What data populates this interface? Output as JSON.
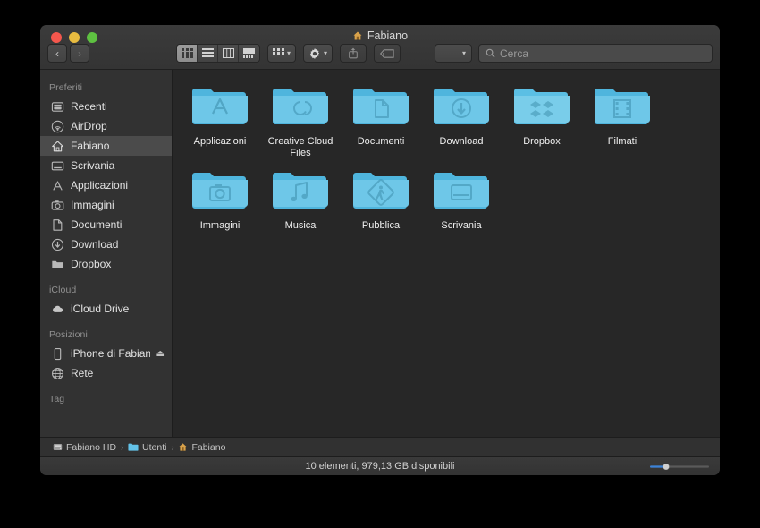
{
  "window": {
    "title": "Fabiano",
    "title_icon": "home-icon",
    "traffic_lights": [
      "close",
      "minimize",
      "zoom"
    ],
    "colors": {
      "red": "#f4574d",
      "yellow": "#e8bb40",
      "green": "#5ec141",
      "folder": "#63c2e8",
      "accent": "#3b7fd4"
    }
  },
  "toolbar": {
    "back_label": "‹",
    "forward_label": "›",
    "view_modes": [
      {
        "name": "icon-view",
        "active": true
      },
      {
        "name": "list-view",
        "active": false
      },
      {
        "name": "column-view",
        "active": false
      },
      {
        "name": "gallery-view",
        "active": false
      }
    ],
    "arrange_label": "arrange-icon",
    "action_label": "gear-icon",
    "share_label": "share-icon",
    "tag_label": "tag-icon",
    "popup_label": "item-popup"
  },
  "search": {
    "placeholder": "Cerca",
    "value": "",
    "icon": "search-icon"
  },
  "sidebar": {
    "sections": [
      {
        "header": "Preferiti",
        "items": [
          {
            "label": "Recenti",
            "icon": "clock-recents-icon",
            "selected": false
          },
          {
            "label": "AirDrop",
            "icon": "airdrop-icon",
            "selected": false
          },
          {
            "label": "Fabiano",
            "icon": "home-icon",
            "selected": true
          },
          {
            "label": "Scrivania",
            "icon": "desktop-icon",
            "selected": false
          },
          {
            "label": "Applicazioni",
            "icon": "applications-icon",
            "selected": false
          },
          {
            "label": "Immagini",
            "icon": "pictures-icon",
            "selected": false
          },
          {
            "label": "Documenti",
            "icon": "documents-icon",
            "selected": false
          },
          {
            "label": "Download",
            "icon": "downloads-icon",
            "selected": false
          },
          {
            "label": "Dropbox",
            "icon": "folder-icon",
            "selected": false
          }
        ]
      },
      {
        "header": "iCloud",
        "items": [
          {
            "label": "iCloud Drive",
            "icon": "cloud-icon",
            "selected": false
          }
        ]
      },
      {
        "header": "Posizioni",
        "items": [
          {
            "label": "iPhone di Fabian…",
            "icon": "iphone-icon",
            "selected": false,
            "eject": "⏏"
          },
          {
            "label": "Rete",
            "icon": "network-globe-icon",
            "selected": false
          }
        ]
      },
      {
        "header": "Tag",
        "items": []
      }
    ]
  },
  "content": {
    "items": [
      {
        "name": "Applicazioni",
        "glyph": "applications-folder"
      },
      {
        "name": "Creative Cloud Files",
        "glyph": "creative-cloud-folder"
      },
      {
        "name": "Documenti",
        "glyph": "documents-folder"
      },
      {
        "name": "Download",
        "glyph": "downloads-folder"
      },
      {
        "name": "Dropbox",
        "glyph": "dropbox-folder"
      },
      {
        "name": "Filmati",
        "glyph": "movies-folder"
      },
      {
        "name": "Immagini",
        "glyph": "pictures-folder"
      },
      {
        "name": "Musica",
        "glyph": "music-folder"
      },
      {
        "name": "Pubblica",
        "glyph": "public-folder"
      },
      {
        "name": "Scrivania",
        "glyph": "desktop-folder"
      }
    ]
  },
  "pathbar": {
    "crumbs": [
      {
        "label": "Fabiano HD",
        "icon": "harddisk-icon"
      },
      {
        "label": "Utenti",
        "icon": "folder-icon"
      },
      {
        "label": "Fabiano",
        "icon": "home-icon"
      }
    ],
    "separator": "›"
  },
  "statusbar": {
    "text": "10 elementi, 979,13 GB disponibili",
    "zoom_slider_value": 25
  }
}
